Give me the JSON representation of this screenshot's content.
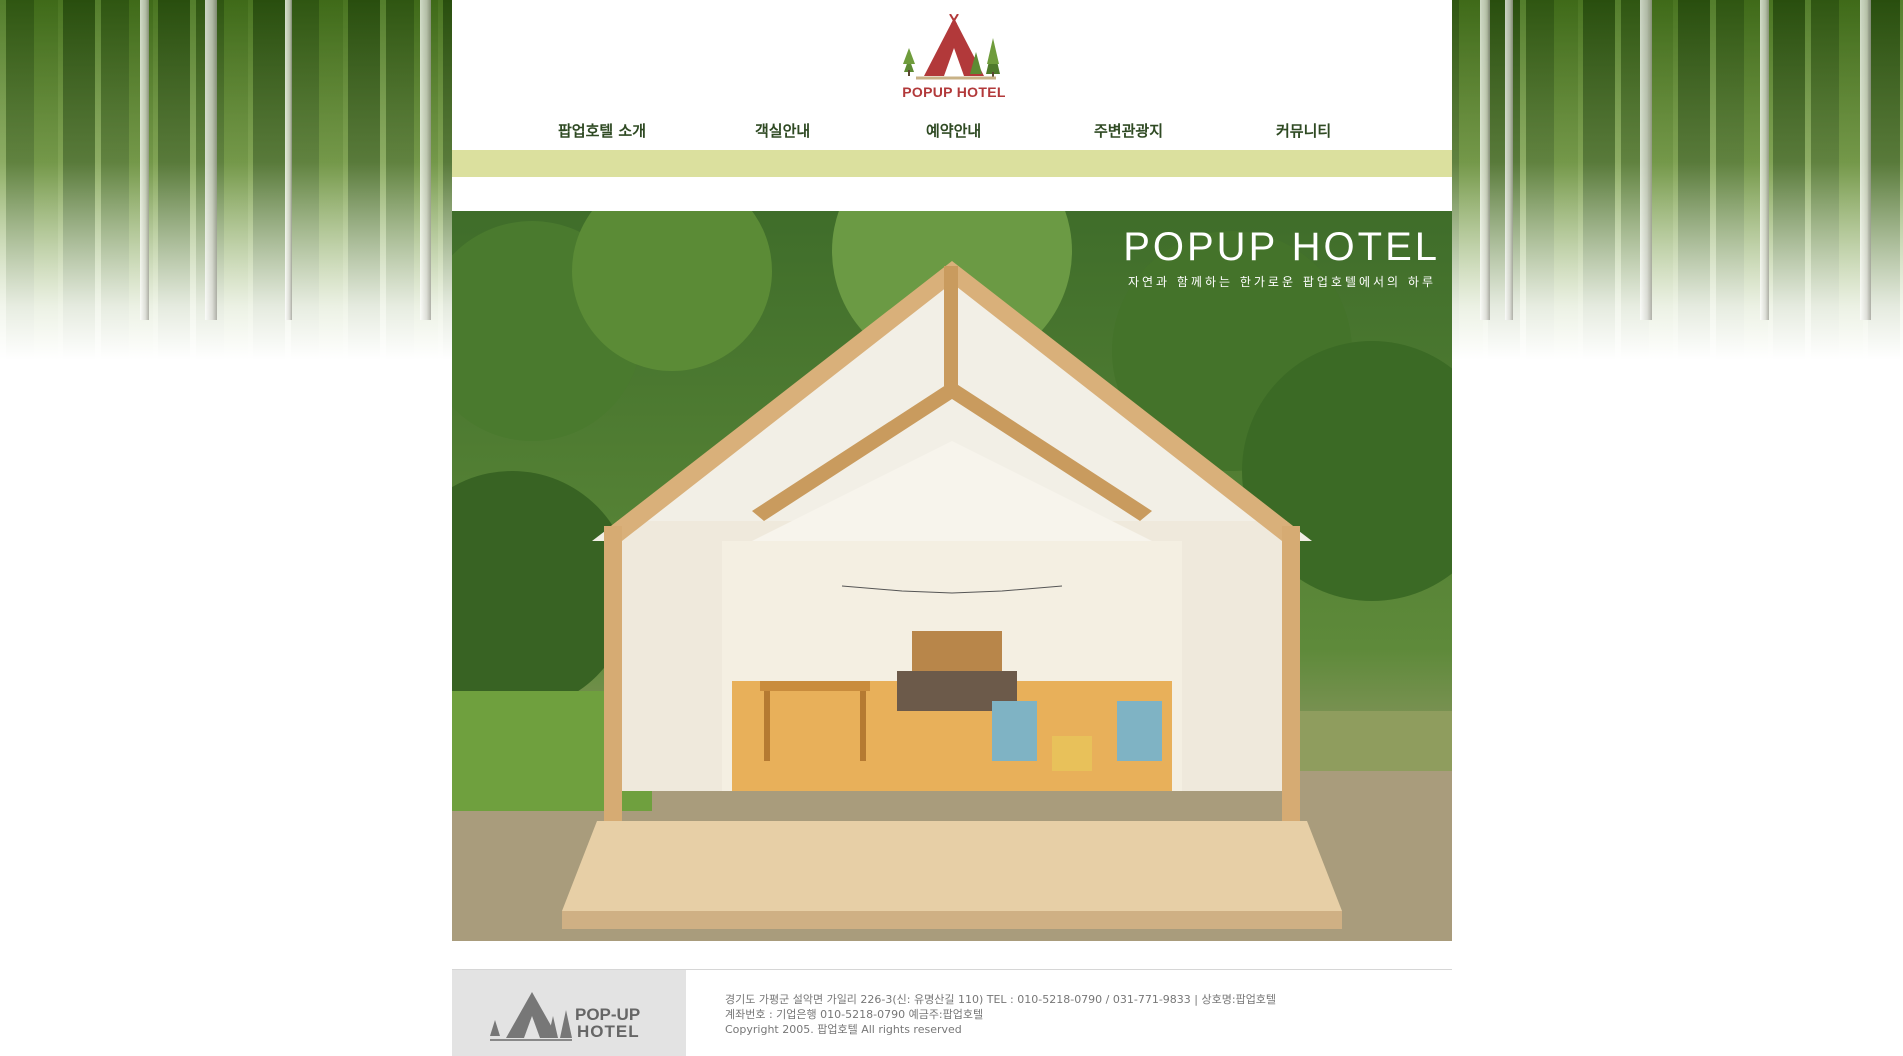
{
  "site": {
    "logo_text": "POPUP HOTEL"
  },
  "nav": {
    "items": [
      {
        "label": "팝업호텔 소개"
      },
      {
        "label": "객실안내"
      },
      {
        "label": "예약안내"
      },
      {
        "label": "주변관광지"
      },
      {
        "label": "커뮤니티"
      }
    ]
  },
  "hero": {
    "title": "POPUP HOTEL",
    "subtitle": "자연과 함께하는 한가로운 팝업호텔에서의 하루"
  },
  "footer": {
    "logo_line1": "POP-UP",
    "logo_line2": "HOTEL",
    "address_line": "경기도 가평군 설악면 가일리 226-3(신: 유명산길 110) TEL : 010-5218-0790 / 031-771-9833  |  상호명:팝업호텔",
    "account_line": "계좌번호 : 기업은행 010-5218-0790  예금주:팝업호텔",
    "copyright": "Copyright 2005. 팝업호텔 All rights reserved"
  },
  "colors": {
    "nav_bar": "#dbe09e",
    "nav_text": "#2f4a23",
    "logo_red": "#b2393a",
    "logo_green": "#5d8a33"
  }
}
